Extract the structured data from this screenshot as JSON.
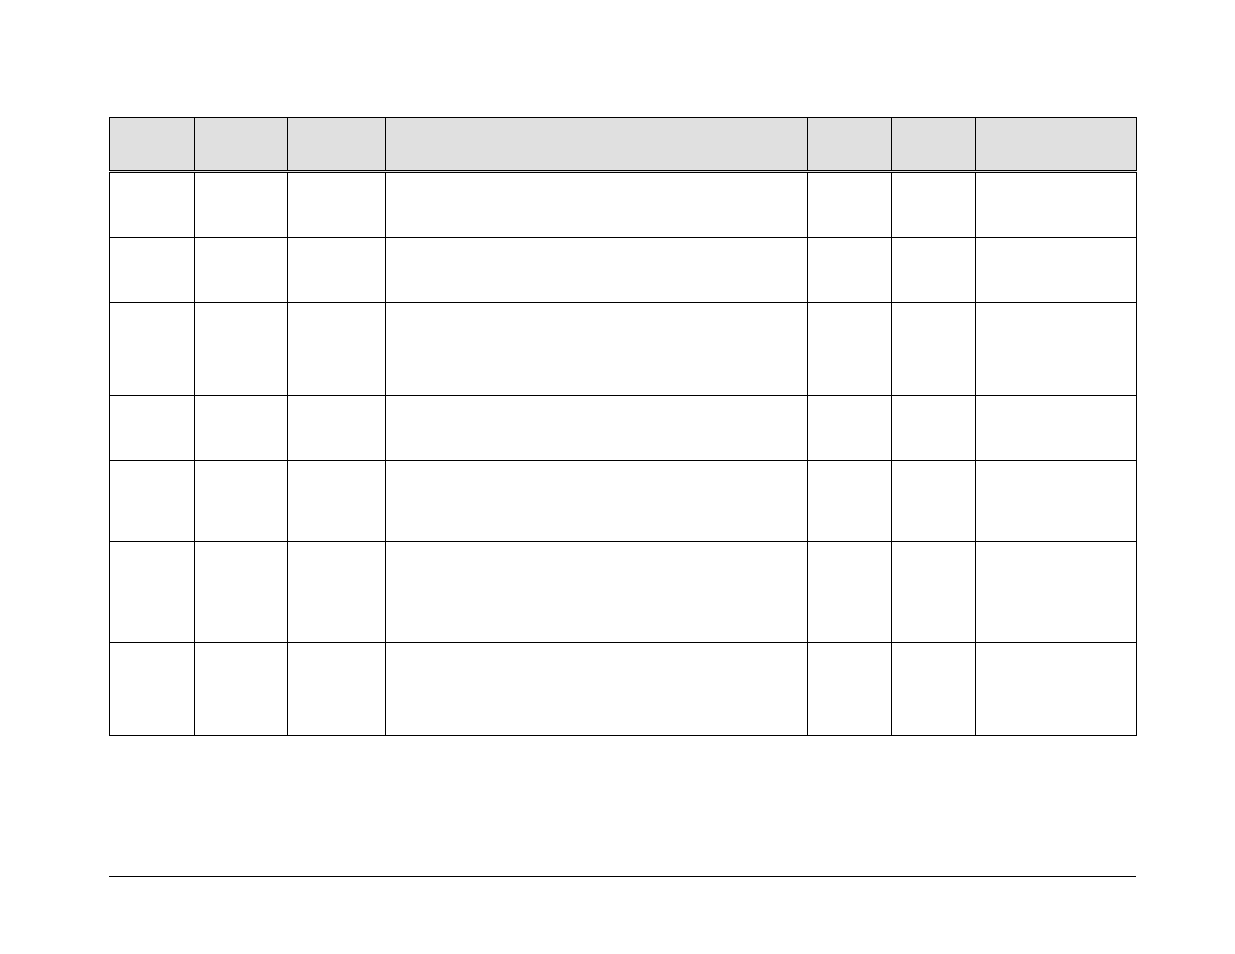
{
  "table": {
    "headers": [
      "",
      "",
      "",
      "",
      "",
      "",
      ""
    ],
    "rows": [
      [
        "",
        "",
        "",
        "",
        "",
        "",
        ""
      ],
      [
        "",
        "",
        "",
        "",
        "",
        "",
        ""
      ],
      [
        "",
        "",
        "",
        "",
        "",
        "",
        ""
      ],
      [
        "",
        "",
        "",
        "",
        "",
        "",
        ""
      ],
      [
        "",
        "",
        "",
        "",
        "",
        "",
        ""
      ],
      [
        "",
        "",
        "",
        "",
        "",
        "",
        ""
      ],
      [
        "",
        "",
        "",
        "",
        "",
        "",
        ""
      ]
    ]
  }
}
